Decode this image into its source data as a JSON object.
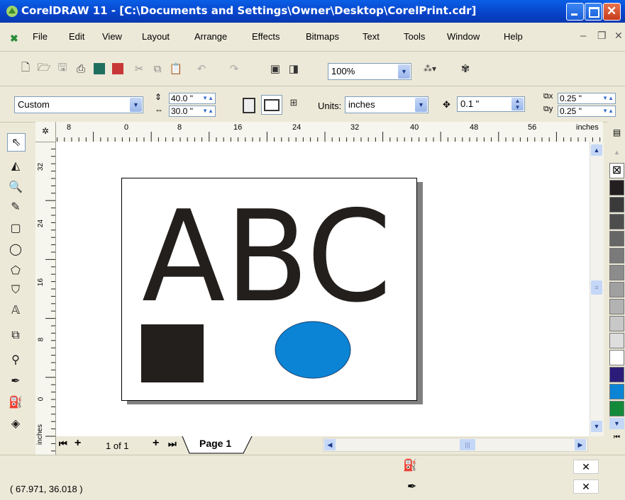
{
  "window": {
    "title": "CorelDRAW 11 - [C:\\Documents and Settings\\Owner\\Desktop\\CorelPrint.cdr]"
  },
  "menu": {
    "items": [
      {
        "label": "File"
      },
      {
        "label": "Edit"
      },
      {
        "label": "View"
      },
      {
        "label": "Layout"
      },
      {
        "label": "Arrange"
      },
      {
        "label": "Effects"
      },
      {
        "label": "Bitmaps"
      },
      {
        "label": "Text"
      },
      {
        "label": "Tools"
      },
      {
        "label": "Window"
      },
      {
        "label": "Help"
      }
    ]
  },
  "standard_toolbar": {
    "zoom_value": "100%"
  },
  "property_bar": {
    "paper_type": "Custom",
    "width": "40.0 \"",
    "height": "30.0 \"",
    "units_label": "Units:",
    "units_value": "inches",
    "nudge": "0.1 \"",
    "dup_x": "0.25 \"",
    "dup_y": "0.25 \""
  },
  "rulers": {
    "h_ticks": [
      "8",
      "0",
      "8",
      "16",
      "24",
      "32",
      "40",
      "48",
      "56"
    ],
    "h_unit": "inches",
    "v_ticks": [
      "32",
      "24",
      "16",
      "8",
      "0"
    ],
    "v_unit": "inches"
  },
  "document": {
    "text": "ABC",
    "colors": {
      "text": "#231f1c",
      "square": "#231f1c",
      "ellipse": "#0b84d6",
      "shadow": "#808080"
    }
  },
  "page_nav": {
    "counter": "1 of 1",
    "tab": "Page 1"
  },
  "palette": {
    "colors": [
      "#231f20",
      "#3a3a3a",
      "#4d4d4d",
      "#666666",
      "#7a7a7a",
      "#8c8c8c",
      "#a0a0a0",
      "#b3b3b3",
      "#c8c8c8",
      "#dedede",
      "#ffffff",
      "#2c1c7a",
      "#0b84d6",
      "#128a3a"
    ]
  },
  "status": {
    "coords": "( 67.971, 36.018 )"
  }
}
